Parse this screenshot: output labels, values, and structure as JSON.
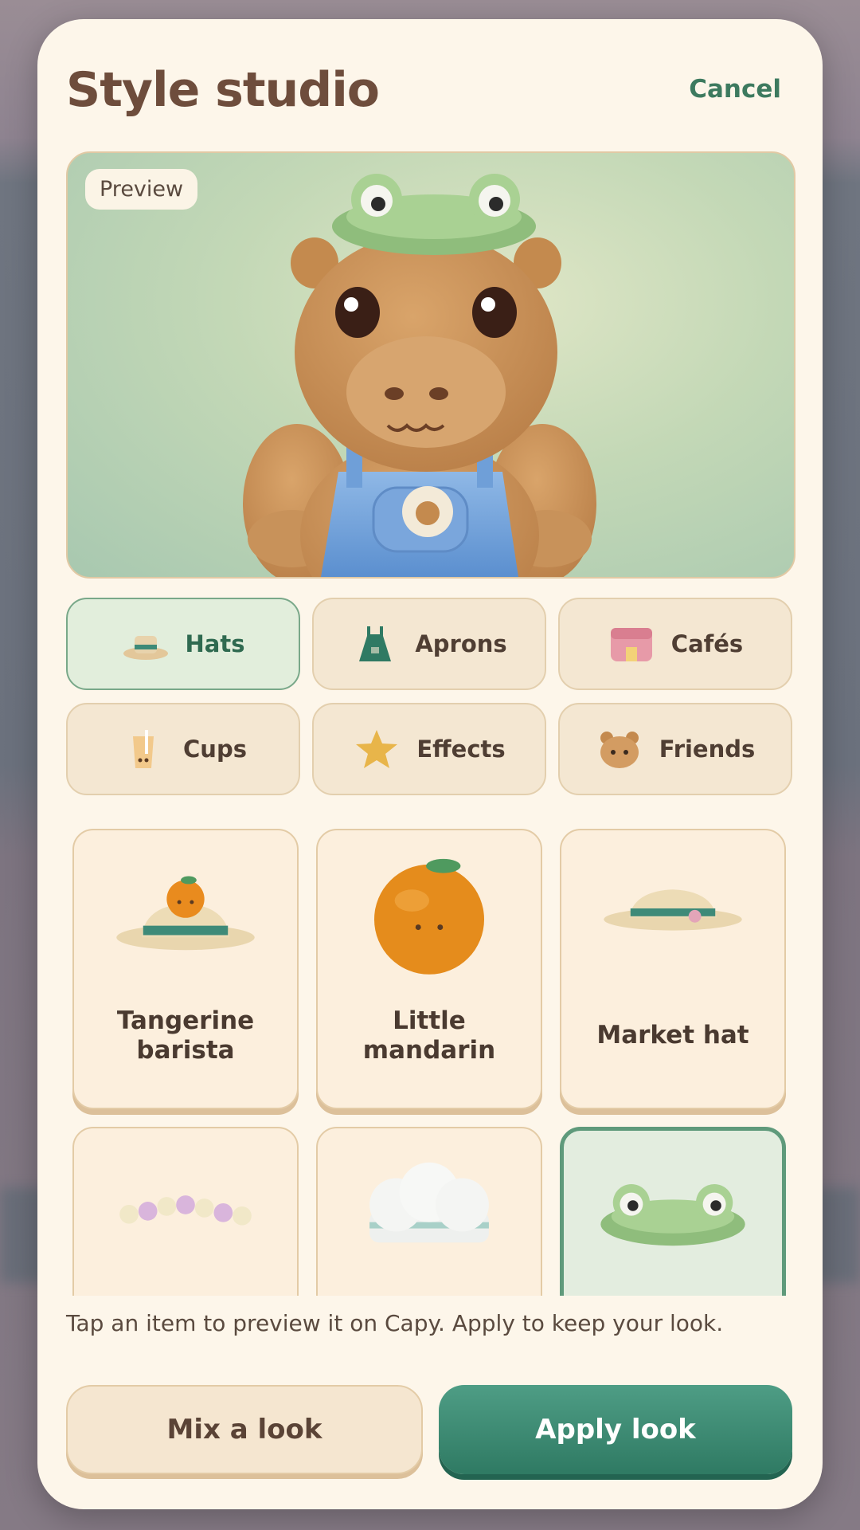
{
  "sheet": {
    "title": "Style studio",
    "cancel_label": "Cancel"
  },
  "preview": {
    "badge": "Preview",
    "character_name": "Capy"
  },
  "tabs": [
    {
      "label": "Hats",
      "icon": "hat-icon",
      "active": true
    },
    {
      "label": "Aprons",
      "icon": "apron-icon",
      "active": false
    },
    {
      "label": "Cafés",
      "icon": "cafe-icon",
      "active": false
    },
    {
      "label": "Cups",
      "icon": "cup-icon",
      "active": false
    },
    {
      "label": "Effects",
      "icon": "star-icon",
      "active": false
    },
    {
      "label": "Friends",
      "icon": "bear-face-icon",
      "active": false
    }
  ],
  "items": [
    {
      "label": "Tangerine barista",
      "icon": "tangerine-hat-icon",
      "selected": false
    },
    {
      "label": "Little mandarin",
      "icon": "mandarin-icon",
      "selected": false
    },
    {
      "label": "Market hat",
      "icon": "market-hat-icon",
      "selected": false
    },
    {
      "label": "",
      "icon": "flower-crown-icon",
      "selected": false
    },
    {
      "label": "",
      "icon": "chef-hat-icon",
      "selected": false
    },
    {
      "label": "",
      "icon": "frog-hat-icon",
      "selected": true
    }
  ],
  "hint": "Tap an item to preview it on Capy. Apply to keep your look.",
  "actions": {
    "mix_label": "Mix a look",
    "apply_label": "Apply look"
  },
  "colors": {
    "accent_green": "#2f7a63",
    "sheet_bg": "#fdf6ea",
    "title_brown": "#6e4d3c"
  }
}
